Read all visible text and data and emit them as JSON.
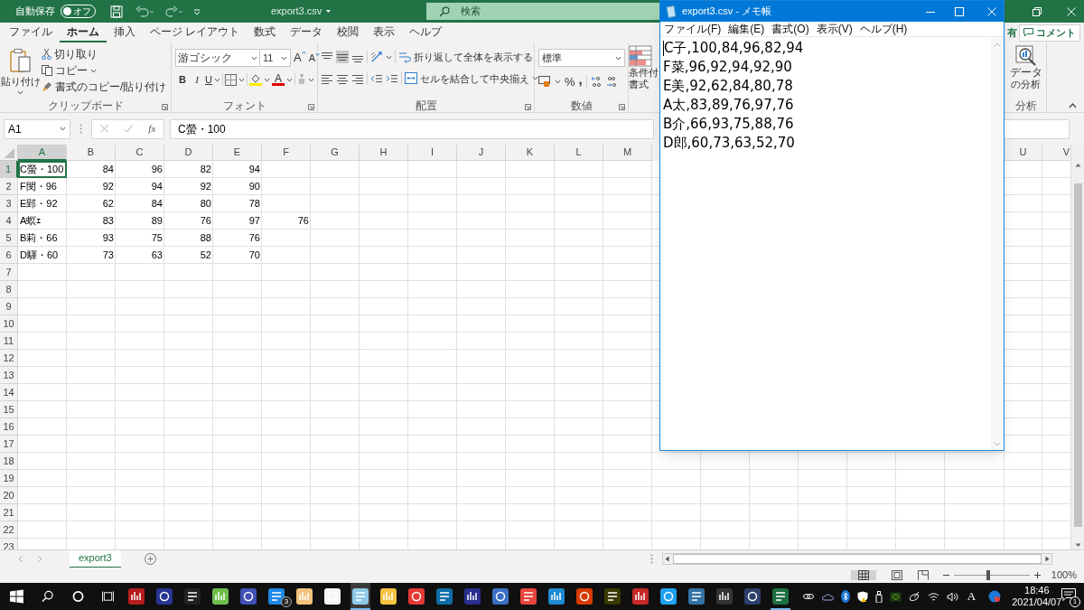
{
  "excel": {
    "title_bar": {
      "autosave_label": "自動保存",
      "autosave_toggle": {
        "label": "オフ",
        "on": false
      },
      "file_title": "export3.csv",
      "search_placeholder": "検索"
    },
    "ribbon_tabs": [
      {
        "label": "ファイル",
        "selected": false
      },
      {
        "label": "ホーム",
        "selected": true
      },
      {
        "label": "挿入",
        "selected": false
      },
      {
        "label": "ページ レイアウト",
        "selected": false
      },
      {
        "label": "数式",
        "selected": false
      },
      {
        "label": "データ",
        "selected": false
      },
      {
        "label": "校閲",
        "selected": false
      },
      {
        "label": "表示",
        "selected": false
      },
      {
        "label": "ヘルプ",
        "selected": false
      }
    ],
    "share_button": "有",
    "comment_button": "コメント",
    "ribbon": {
      "clipboard": {
        "paste": "貼り付け",
        "cut": "切り取り",
        "copy": "コピー",
        "format_painter": "書式のコピー/貼り付け",
        "group": "クリップボード"
      },
      "font": {
        "name": "游ゴシック",
        "size": "11",
        "grow": "A",
        "shrink": "A",
        "bold": "B",
        "italic": "I",
        "underline": "U",
        "font_color": "A",
        "group": "フォント"
      },
      "alignment": {
        "wrap": "折り返して全体を表示する",
        "merge": "セルを結合して中央揃え",
        "group": "配置"
      },
      "number": {
        "format": "標準",
        "percent": "%",
        "comma": ",",
        "group": "数値"
      },
      "conditional": {
        "line1": "条件付",
        "line2": "書式"
      },
      "analysis": {
        "line1": "データ",
        "line2": "の分析",
        "group": "分析"
      }
    },
    "formula_bar": {
      "name_box": "A1",
      "function_label": "fx",
      "formula": "C螢・100"
    },
    "sheet": {
      "columns_left": [
        "A",
        "B",
        "C",
        "D",
        "E",
        "F",
        "G",
        "H",
        "I",
        "J",
        "K",
        "L",
        "M"
      ],
      "columns_right": [
        "U",
        "V"
      ],
      "rows": [
        {
          "header": "1",
          "cells": [
            {
              "value": "C螢・100",
              "selected": true
            },
            {
              "value": "84",
              "selected": false
            },
            {
              "value": "96",
              "selected": false
            },
            {
              "value": "82",
              "selected": false
            },
            {
              "value": "94",
              "selected": false
            }
          ]
        },
        {
          "header": "2",
          "cells": [
            {
              "value": "F閔・96",
              "selected": false
            },
            {
              "value": "92",
              "selected": false
            },
            {
              "value": "94",
              "selected": false
            },
            {
              "value": "92",
              "selected": false
            },
            {
              "value": "90",
              "selected": false
            }
          ]
        },
        {
          "header": "3",
          "cells": [
            {
              "value": "E郢・92",
              "selected": false
            },
            {
              "value": "62",
              "selected": false
            },
            {
              "value": "84",
              "selected": false
            },
            {
              "value": "80",
              "selected": false
            },
            {
              "value": "78",
              "selected": false
            }
          ]
        },
        {
          "header": "4",
          "cells": [
            {
              "value": "A螟ｪ",
              "selected": false
            },
            {
              "value": "83",
              "selected": false
            },
            {
              "value": "89",
              "selected": false
            },
            {
              "value": "76",
              "selected": false
            },
            {
              "value": "97",
              "selected": false
            },
            {
              "value": "76",
              "selected": false
            }
          ]
        },
        {
          "header": "5",
          "cells": [
            {
              "value": "B莉・66",
              "selected": false
            },
            {
              "value": "93",
              "selected": false
            },
            {
              "value": "75",
              "selected": false
            },
            {
              "value": "88",
              "selected": false
            },
            {
              "value": "76",
              "selected": false
            }
          ]
        },
        {
          "header": "6",
          "cells": [
            {
              "value": "D驛・60",
              "selected": false
            },
            {
              "value": "73",
              "selected": false
            },
            {
              "value": "63",
              "selected": false
            },
            {
              "value": "52",
              "selected": false
            },
            {
              "value": "70",
              "selected": false
            }
          ]
        },
        {
          "header": "7"
        },
        {
          "header": "8"
        },
        {
          "header": "9"
        },
        {
          "header": "10"
        },
        {
          "header": "11"
        },
        {
          "header": "12"
        },
        {
          "header": "13"
        },
        {
          "header": "14"
        },
        {
          "header": "15"
        },
        {
          "header": "16"
        },
        {
          "header": "17"
        },
        {
          "header": "18"
        },
        {
          "header": "19"
        },
        {
          "header": "20"
        },
        {
          "header": "21"
        },
        {
          "header": "22"
        },
        {
          "header": "23"
        }
      ]
    },
    "sheet_tabs": [
      {
        "label": "export3",
        "selected": true
      }
    ],
    "status_bar": {
      "zoom": {
        "level": 0.46
      },
      "zoom_reading": "100%"
    }
  },
  "notepad": {
    "title": "export3.csv - メモ帳",
    "menu": [
      "ファイル(F)",
      "編集(E)",
      "書式(O)",
      "表示(V)",
      "ヘルプ(H)"
    ],
    "lines": [
      "C子,100,84,96,82,94",
      "F菜,96,92,94,92,90",
      "E美,92,62,84,80,78",
      "A太,83,89,76,97,76",
      "B介,66,93,75,88,76",
      "D郎,60,73,63,52,70"
    ]
  },
  "taskbar": {
    "mail_badge": "3",
    "clock_time": "18:46",
    "clock_date": "2021/04/07",
    "ime_indicator": "A",
    "notification_badge": "1"
  }
}
